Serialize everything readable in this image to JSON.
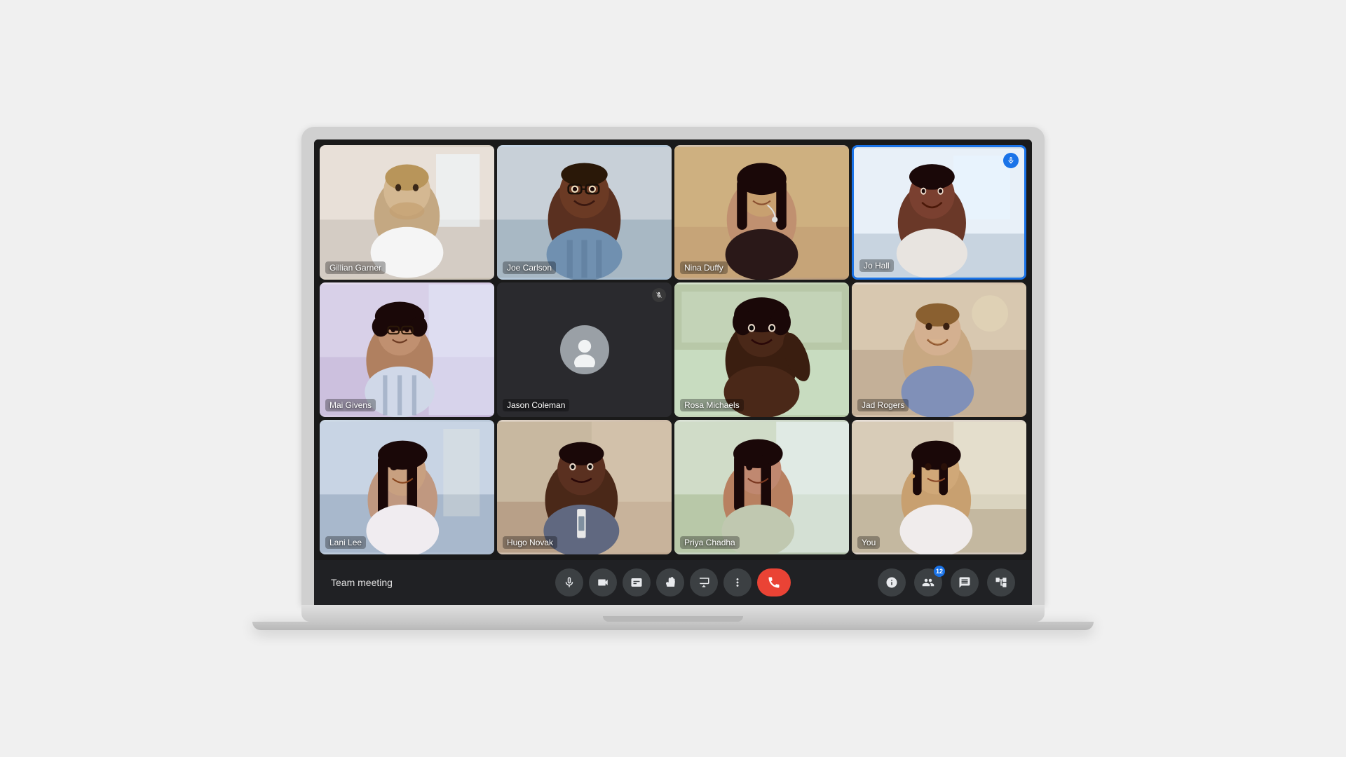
{
  "meeting": {
    "title": "Team meeting",
    "participants_count": "12"
  },
  "participants": [
    {
      "id": 1,
      "name": "Gillian Garner",
      "camera_on": true,
      "muted": false,
      "active_speaker": false,
      "bg_class": "bg-1",
      "skin": "#c8a882",
      "hair": "#4a3020"
    },
    {
      "id": 2,
      "name": "Joe Carlson",
      "camera_on": true,
      "muted": false,
      "active_speaker": false,
      "bg_class": "bg-2",
      "skin": "#6b3a2a",
      "hair": "#1a1008"
    },
    {
      "id": 3,
      "name": "Nina Duffy",
      "camera_on": true,
      "muted": false,
      "active_speaker": false,
      "bg_class": "bg-3",
      "skin": "#c09070",
      "hair": "#1a0a0a"
    },
    {
      "id": 4,
      "name": "Jo Hall",
      "camera_on": true,
      "muted": false,
      "active_speaker": true,
      "bg_class": "bg-4",
      "skin": "#7a5040",
      "hair": "#1a0a0a"
    },
    {
      "id": 5,
      "name": "Mai Givens",
      "camera_on": true,
      "muted": false,
      "active_speaker": false,
      "bg_class": "bg-5",
      "skin": "#b08060",
      "hair": "#1a0a0a"
    },
    {
      "id": 6,
      "name": "Jason Coleman",
      "camera_on": false,
      "muted": true,
      "active_speaker": false,
      "bg_class": "bg-6",
      "skin": "#8a6040",
      "hair": "#1a0a0a"
    },
    {
      "id": 7,
      "name": "Rosa Michaels",
      "camera_on": true,
      "muted": false,
      "active_speaker": false,
      "bg_class": "bg-7",
      "skin": "#4a2818",
      "hair": "#0a0508"
    },
    {
      "id": 8,
      "name": "Jad Rogers",
      "camera_on": true,
      "muted": false,
      "active_speaker": false,
      "bg_class": "bg-8",
      "skin": "#d0a880",
      "hair": "#8a6030"
    },
    {
      "id": 9,
      "name": "Lani Lee",
      "camera_on": true,
      "muted": false,
      "active_speaker": false,
      "bg_class": "bg-9",
      "skin": "#c0987a",
      "hair": "#1a0a0a"
    },
    {
      "id": 10,
      "name": "Hugo Novak",
      "camera_on": true,
      "muted": false,
      "active_speaker": false,
      "bg_class": "bg-10",
      "skin": "#5a3820",
      "hair": "#1a0a0a"
    },
    {
      "id": 11,
      "name": "Priya Chadha",
      "camera_on": true,
      "muted": false,
      "active_speaker": false,
      "bg_class": "bg-11",
      "skin": "#b88060",
      "hair": "#1a0a0a"
    },
    {
      "id": 12,
      "name": "You",
      "camera_on": true,
      "muted": false,
      "active_speaker": false,
      "bg_class": "bg-12",
      "skin": "#c8a070",
      "hair": "#1a0a0a"
    }
  ],
  "toolbar": {
    "meeting_name": "Team meeting",
    "buttons": {
      "mic_label": "Microphone",
      "camera_label": "Camera",
      "captions_label": "Captions",
      "raise_hand_label": "Raise hand",
      "present_label": "Present now",
      "more_label": "More options",
      "end_call_label": "Leave call"
    },
    "right_buttons": {
      "info_label": "Meeting details",
      "people_label": "People",
      "chat_label": "Chat",
      "activities_label": "Activities"
    }
  },
  "colors": {
    "toolbar_bg": "#202124",
    "tile_bg": "#1a1a1a",
    "active_border": "#1a73e8",
    "end_call": "#ea4335",
    "icon_bg": "#3c4043",
    "badge_bg": "#1a73e8"
  }
}
